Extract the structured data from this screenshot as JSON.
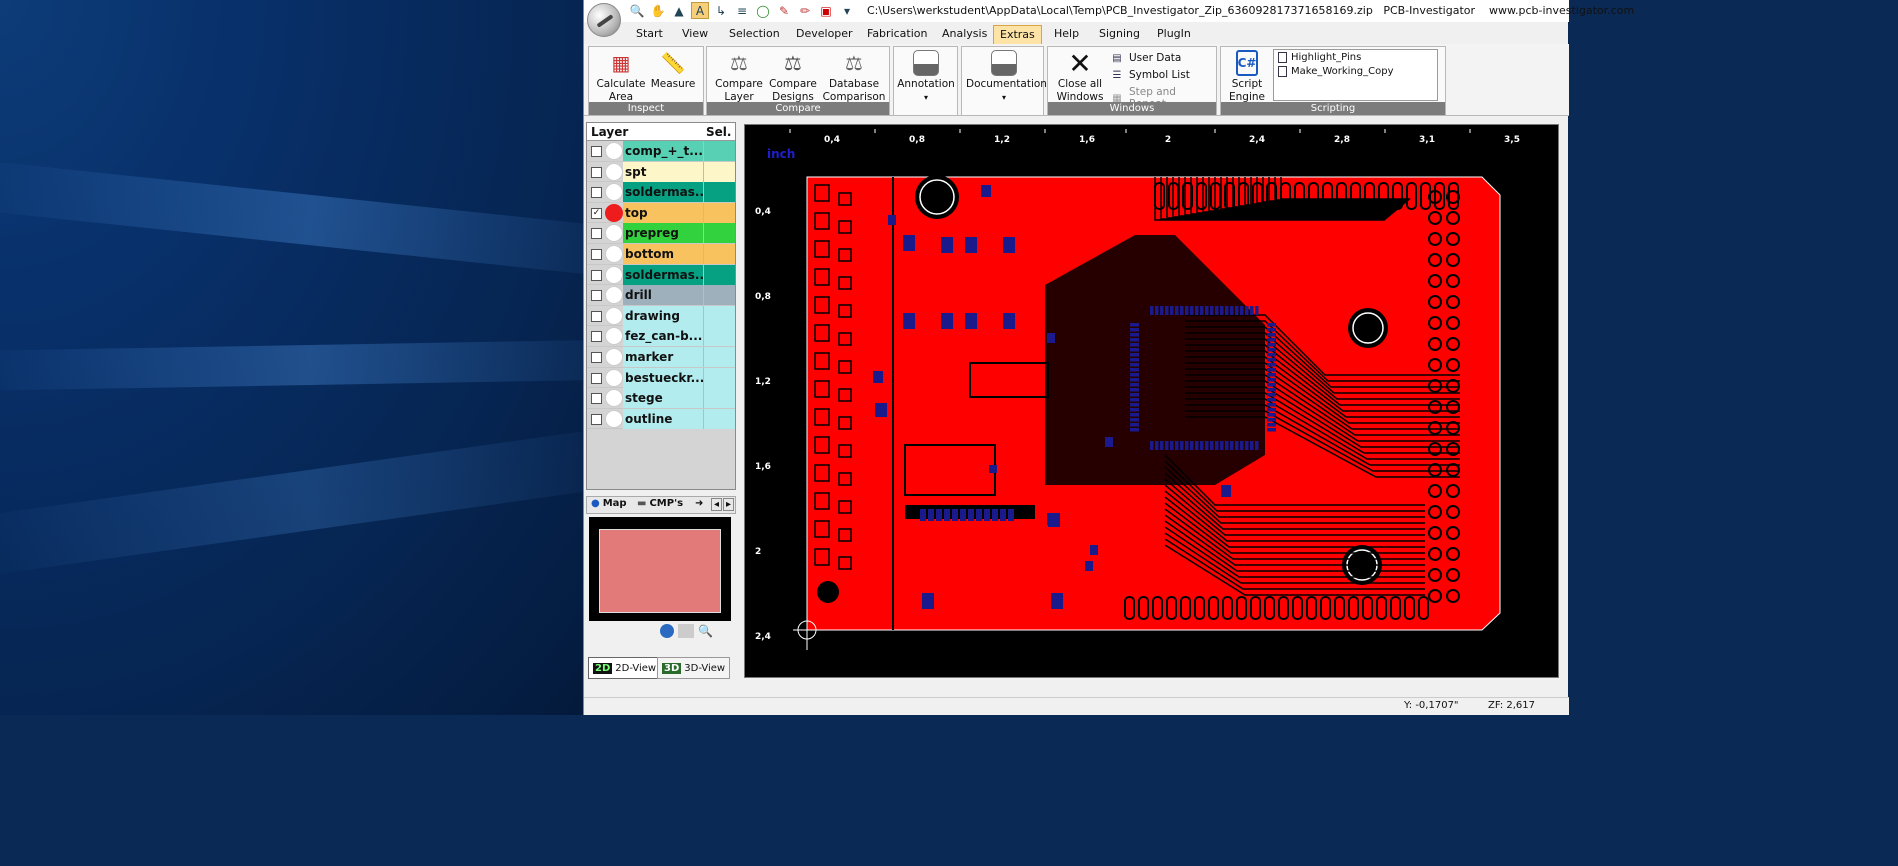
{
  "window": {
    "path": "C:\\Users\\werkstudent\\AppData\\Local\\Temp\\PCB_Investigator_Zip_636092817371658169.zip",
    "app_name": "PCB-Investigator",
    "website": "www.pcb-investigator.com"
  },
  "tabs": [
    {
      "label": "Start"
    },
    {
      "label": "View"
    },
    {
      "label": "Selection"
    },
    {
      "label": "Developer"
    },
    {
      "label": "Fabrication"
    },
    {
      "label": "Analysis"
    },
    {
      "label": "Extras",
      "active": true
    },
    {
      "label": "Help"
    },
    {
      "label": "Signing"
    },
    {
      "label": "PlugIn"
    }
  ],
  "ribbon": {
    "inspect": {
      "label": "Inspect",
      "calc_area": "Calculate Area",
      "measure": "Measure"
    },
    "compare": {
      "label": "Compare",
      "compare_layer": "Compare Layer",
      "compare_designs": "Compare Designs",
      "database_comparison": "Database Comparison"
    },
    "annotation": "Annotation",
    "documentation": "Documentation",
    "windows": {
      "label": "Windows",
      "close_all": "Close all Windows",
      "user_data": "User Data",
      "symbol_list": "Symbol List",
      "step_repeat": "Step and Repeat"
    },
    "scripting": {
      "label": "Scripting",
      "script_engine": "Script Engine",
      "scripts": [
        "Highlight_Pins",
        "Make_Working_Copy"
      ]
    }
  },
  "layer_panel": {
    "col_layer": "Layer",
    "col_sel": "Sel.",
    "layers": [
      {
        "name": "comp_+_t...",
        "color": "#58d0b4",
        "checked": false
      },
      {
        "name": "spt",
        "color": "#fdf6c8",
        "checked": false
      },
      {
        "name": "soldermas...",
        "color": "#06a182",
        "checked": false
      },
      {
        "name": "top",
        "color": "#f8c25e",
        "checked": true,
        "active_color": "#ee1c1c"
      },
      {
        "name": "prepreg",
        "color": "#32d23e",
        "checked": false
      },
      {
        "name": "bottom",
        "color": "#f8c25e",
        "checked": false
      },
      {
        "name": "soldermas...",
        "color": "#06a182",
        "checked": false
      },
      {
        "name": "drill",
        "color": "#9eb0bc",
        "checked": false
      },
      {
        "name": "drawing",
        "color": "#b2ecee",
        "checked": false
      },
      {
        "name": "fez_can-b...",
        "color": "#b2ecee",
        "checked": false
      },
      {
        "name": "marker",
        "color": "#b2ecee",
        "checked": false
      },
      {
        "name": "bestueckr...",
        "color": "#b2ecee",
        "checked": false
      },
      {
        "name": "stege",
        "color": "#b2ecee",
        "checked": false
      },
      {
        "name": "outline",
        "color": "#b2ecee",
        "checked": false
      }
    ]
  },
  "map_panel": {
    "tab_map": "Map",
    "tab_cmps": "CMP's"
  },
  "view_buttons": {
    "view2d": "2D-View",
    "view3d": "3D-View",
    "view2d_icon": "2D",
    "view3d_icon": "3D"
  },
  "canvas": {
    "unit": "inch",
    "x_ticks": [
      "0,4",
      "0,8",
      "1,2",
      "1,6",
      "2",
      "2,4",
      "2,8",
      "3,1",
      "3,5"
    ],
    "y_ticks": [
      "0,4",
      "0,8",
      "1,2",
      "1,6",
      "2",
      "2,4"
    ],
    "board_color": "#ff0000",
    "pad_color": "#1a1a8c"
  },
  "status": {
    "y_coord": "Y: -0,1707\"",
    "zoom": "ZF: 2,617"
  }
}
